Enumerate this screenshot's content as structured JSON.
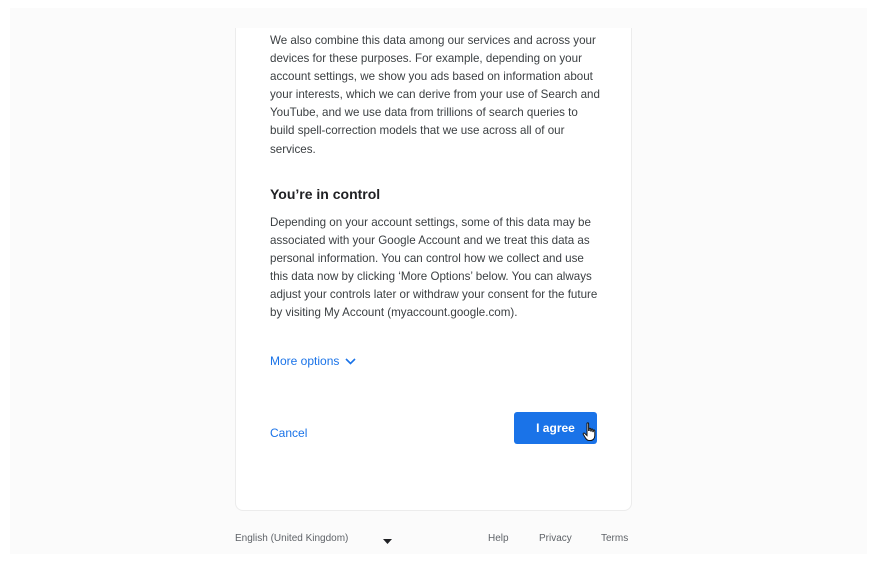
{
  "consent": {
    "intro_paragraph": "We also combine this data among our services and across your devices for these purposes. For example, depending on your account settings, we show you ads based on information about your interests, which we can derive from your use of Search and YouTube, and we use data from trillions of search queries to build spell-correction models that we use across all of our services.",
    "heading": "You’re in control",
    "control_paragraph": "Depending on your account settings, some of this data may be associated with your Google Account and we treat this data as personal information. You can control how we collect and use this data now by clicking ‘More Options’ below. You can always adjust your controls later or withdraw your consent for the future by visiting My Account (myaccount.google.com).",
    "more_options_label": "More options",
    "cancel_label": "Cancel",
    "agree_label": "I agree"
  },
  "footer": {
    "language": "English (United Kingdom)",
    "help": "Help",
    "privacy": "Privacy",
    "terms": "Terms"
  },
  "colors": {
    "accent": "#1a73e8",
    "text": "#3c4043",
    "heading": "#202124"
  },
  "icons": {
    "more_options": "chevron-down-icon",
    "language": "caret-down-icon",
    "cursor": "hand-pointer-icon"
  }
}
